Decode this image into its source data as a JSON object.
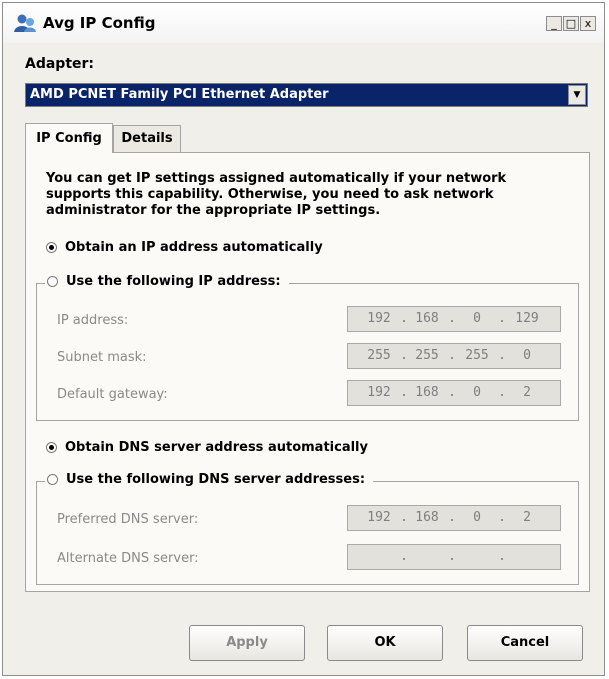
{
  "window": {
    "title": "Avg IP Config",
    "controls": {
      "minimize": "_",
      "maximize": "□",
      "close": "x"
    }
  },
  "adapter": {
    "label": "Adapter:",
    "selected": "AMD PCNET Family PCI Ethernet Adapter"
  },
  "tabs": [
    {
      "label": "IP Config",
      "active": true
    },
    {
      "label": "Details",
      "active": false
    }
  ],
  "ip_config": {
    "intro": "You can get IP settings assigned automatically if your network supports this capability. Otherwise, you need to ask network administrator for the appropriate IP settings.",
    "obtain_ip_auto": {
      "label": "Obtain an IP address automatically",
      "checked": true
    },
    "use_following_ip": {
      "label": "Use the following IP address:",
      "checked": false
    },
    "ip_fields": [
      {
        "label": "IP address:",
        "octets": [
          "192",
          "168",
          "0",
          "129"
        ]
      },
      {
        "label": "Subnet mask:",
        "octets": [
          "255",
          "255",
          "255",
          "0"
        ]
      },
      {
        "label": "Default gateway:",
        "octets": [
          "192",
          "168",
          "0",
          "2"
        ]
      }
    ],
    "obtain_dns_auto": {
      "label": "Obtain DNS server address automatically",
      "checked": true
    },
    "use_following_dns": {
      "label": "Use the following DNS server addresses:",
      "checked": false
    },
    "dns_fields": [
      {
        "label": "Preferred DNS server:",
        "octets": [
          "192",
          "168",
          "0",
          "2"
        ]
      },
      {
        "label": "Alternate DNS server:",
        "octets": [
          "",
          "",
          "",
          ""
        ]
      }
    ]
  },
  "buttons": {
    "apply": "Apply",
    "ok": "OK",
    "cancel": "Cancel"
  }
}
